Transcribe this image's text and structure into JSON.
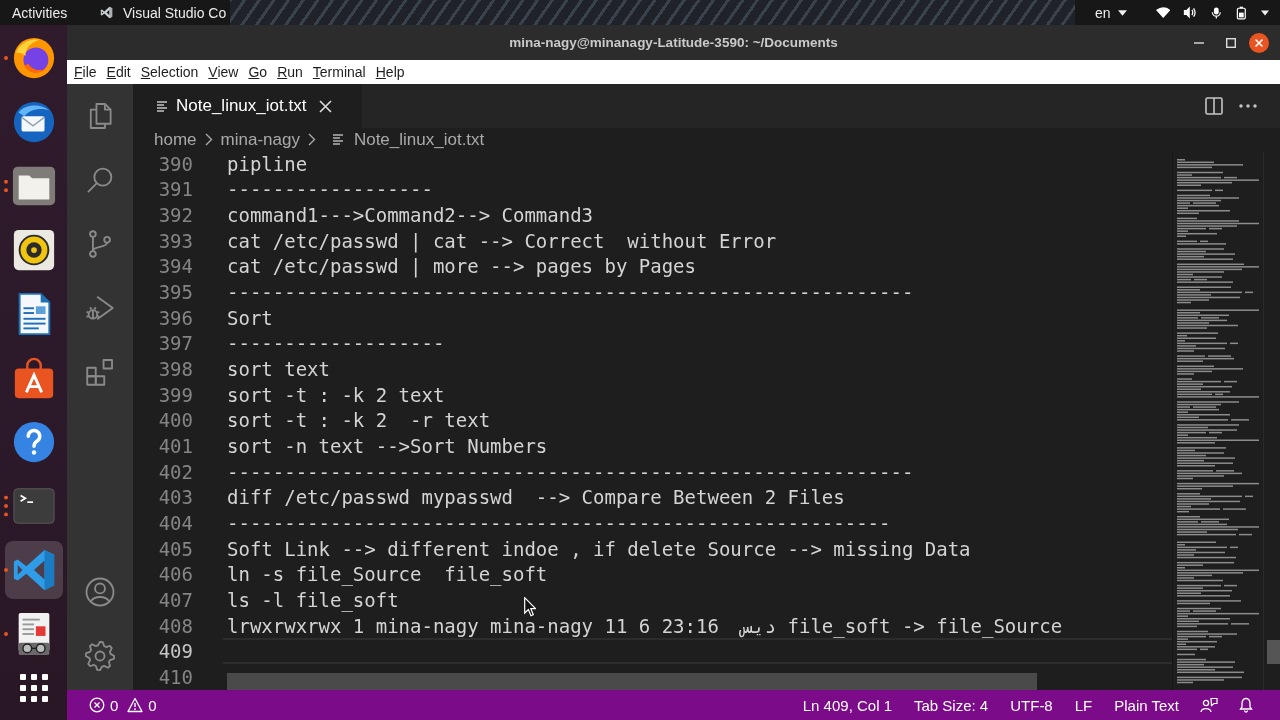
{
  "top_bar": {
    "activities": "Activities",
    "app_menu": "Visual Studio Co",
    "keyboard_layout": "en"
  },
  "dock": {
    "items": [
      {
        "kind": "browser",
        "selected": false,
        "indicator": {
          "kind": "single"
        }
      },
      {
        "kind": "mail",
        "selected": false
      },
      {
        "kind": "files",
        "selected": false,
        "indicator": {
          "kind": "double"
        }
      },
      {
        "kind": "music",
        "selected": false
      },
      {
        "kind": "writer",
        "selected": false
      },
      {
        "kind": "software",
        "selected": false
      },
      {
        "kind": "help",
        "selected": false
      },
      {
        "kind": "terminal",
        "selected": false,
        "indicator": {
          "kind": "triple"
        }
      },
      {
        "kind": "code",
        "selected": true,
        "indicator": {
          "kind": "single"
        }
      },
      {
        "kind": "viewer",
        "selected": false,
        "indicator": {
          "kind": "single"
        }
      }
    ]
  },
  "window": {
    "title": "mina-nagy@minanagy-Latitude-3590: ~/Documents"
  },
  "menu_bar": [
    "File",
    "Edit",
    "Selection",
    "View",
    "Go",
    "Run",
    "Terminal",
    "Help"
  ],
  "activity_bar": {
    "items": [
      {
        "kind": "explorer",
        "selected": false
      },
      {
        "kind": "search",
        "selected": false
      },
      {
        "kind": "source_control",
        "selected": false
      },
      {
        "kind": "run",
        "selected": false
      },
      {
        "kind": "extensions",
        "selected": false
      }
    ],
    "bottom_items": [
      {
        "kind": "account",
        "selected": false
      },
      {
        "kind": "settings",
        "selected": false
      }
    ]
  },
  "tabs": [
    {
      "label": "Note_linux_iot.txt",
      "selected": true
    }
  ],
  "breadcrumbs": [
    {
      "label": "home",
      "kind": "folder"
    },
    {
      "label": "mina-nagy",
      "kind": "folder"
    },
    {
      "label": "Note_linux_iot.txt",
      "kind": "file"
    }
  ],
  "editor": {
    "lines": [
      {
        "number": "390",
        "text": "pipline",
        "current": false
      },
      {
        "number": "391",
        "text": "------------------",
        "current": false
      },
      {
        "number": "392",
        "text": "command1--->Command2--> Command3",
        "current": false
      },
      {
        "number": "393",
        "text": "cat /etc/passwd | cat --> Correct  without Error",
        "current": false
      },
      {
        "number": "394",
        "text": "cat /etc/passwd | more --> pages by Pages",
        "current": false
      },
      {
        "number": "395",
        "text": "------------------------------------------------------------",
        "current": false
      },
      {
        "number": "396",
        "text": "Sort",
        "current": false
      },
      {
        "number": "397",
        "text": "-------------------",
        "current": false
      },
      {
        "number": "398",
        "text": "sort text",
        "current": false
      },
      {
        "number": "399",
        "text": "sort -t : -k 2 text",
        "current": false
      },
      {
        "number": "400",
        "text": "sort -t : -k 2  -r text",
        "current": false
      },
      {
        "number": "401",
        "text": "sort -n text -->Sort Numbers",
        "current": false
      },
      {
        "number": "402",
        "text": "------------------------------------------------------------",
        "current": false
      },
      {
        "number": "403",
        "text": "diff /etc/passwd mypasswd  --> Compare Between 2 Files",
        "current": false
      },
      {
        "number": "404",
        "text": "----------------------------------------------------------",
        "current": false
      },
      {
        "number": "405",
        "text": "Soft Link --> different indoe , if delete Source --> missing Data",
        "current": false
      },
      {
        "number": "406",
        "text": "ln -s file_Source  file_soft",
        "current": false
      },
      {
        "number": "407",
        "text": "ls -l file_soft",
        "current": false
      },
      {
        "number": "408",
        "text": "lrwxrwxrwx 1 mina-nagy mina-nagy 11 6 23:16  ديس file_soft -> file_Source",
        "current": false
      },
      {
        "number": "409",
        "current": true
      },
      {
        "number": "410",
        "current": false
      }
    ]
  },
  "status_bar": {
    "errors": "0",
    "warnings": "0",
    "items": [
      "Ln 409, Col 1",
      "Tab Size: 4",
      "UTF-8",
      "LF",
      "Plain Text"
    ]
  }
}
